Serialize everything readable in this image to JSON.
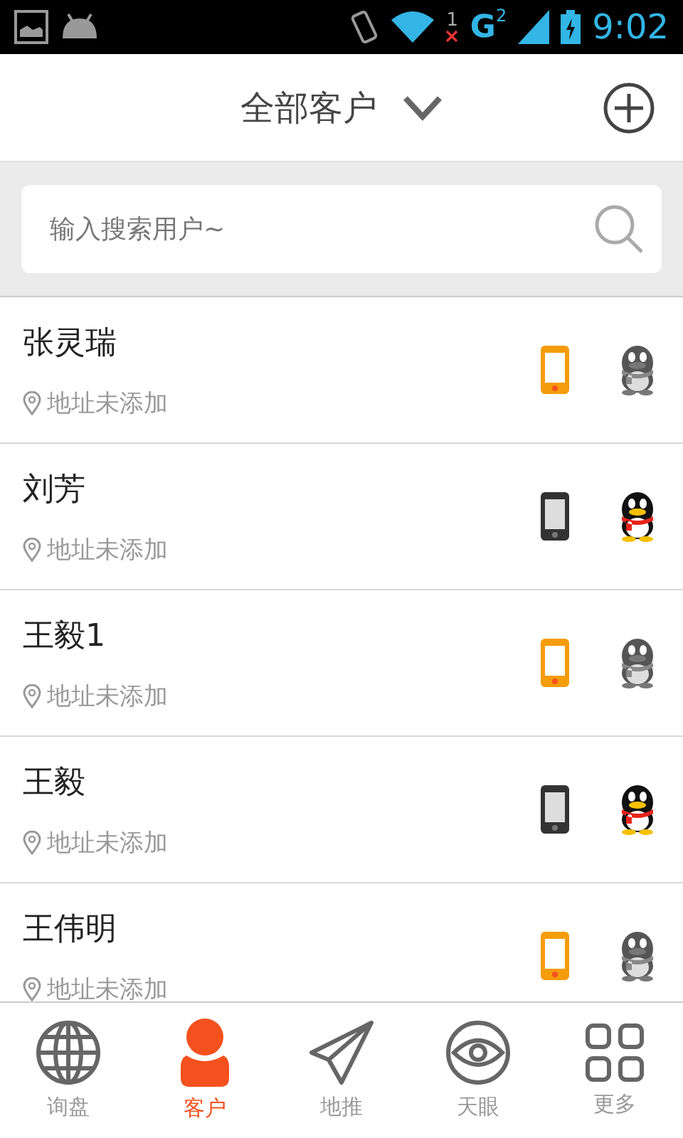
{
  "status_bar": {
    "sim1": "1",
    "network": "G",
    "sim2": "2",
    "time": "9:02"
  },
  "header": {
    "title": "全部客户"
  },
  "search": {
    "placeholder": "输入搜索用户~"
  },
  "customers": [
    {
      "name": "张灵瑞",
      "address": "地址未添加",
      "phone_active": true,
      "qq_online": false
    },
    {
      "name": "刘芳",
      "address": "地址未添加",
      "phone_active": false,
      "qq_online": true
    },
    {
      "name": "王毅1",
      "address": "地址未添加",
      "phone_active": true,
      "qq_online": false
    },
    {
      "name": "王毅",
      "address": "地址未添加",
      "phone_active": false,
      "qq_online": true
    },
    {
      "name": "王伟明",
      "address": "地址未添加",
      "phone_active": true,
      "qq_online": false
    }
  ],
  "tabs": [
    {
      "kind": "globe",
      "label": "询盘",
      "selected": false
    },
    {
      "kind": "person",
      "label": "客户",
      "selected": true
    },
    {
      "kind": "plane",
      "label": "地推",
      "selected": false
    },
    {
      "kind": "eye",
      "label": "天眼",
      "selected": false
    },
    {
      "kind": "grid",
      "label": "更多",
      "selected": false
    }
  ]
}
